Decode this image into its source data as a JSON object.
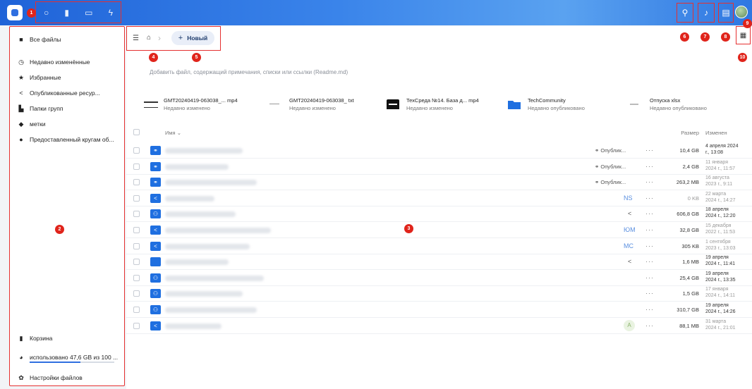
{
  "topbar": {
    "apps": [
      {
        "icon": "circle-icon",
        "glyph": "○"
      },
      {
        "icon": "document-icon",
        "glyph": "▮"
      },
      {
        "icon": "image-icon",
        "glyph": "▭"
      },
      {
        "icon": "bolt-icon",
        "glyph": "ϟ"
      }
    ],
    "right_icons": [
      {
        "icon": "search-icon",
        "glyph": "⚲"
      },
      {
        "icon": "bell-icon",
        "glyph": "♪"
      },
      {
        "icon": "contacts-icon",
        "glyph": "▤"
      }
    ]
  },
  "markers": [
    "1",
    "2",
    "3",
    "4",
    "5",
    "6",
    "7",
    "8",
    "9",
    "10"
  ],
  "sidebar": {
    "items": [
      {
        "label": "Все файлы",
        "icon": "folder-icon",
        "glyph": "■"
      },
      {
        "label": "Недавно изменённые",
        "icon": "clock-icon",
        "glyph": "◷"
      },
      {
        "label": "Избранные",
        "icon": "star-icon",
        "glyph": "★"
      },
      {
        "label": "Опубликованные ресур...",
        "icon": "share-icon",
        "glyph": "<"
      },
      {
        "label": "Папки групп",
        "icon": "group-folder-icon",
        "glyph": "▙"
      },
      {
        "label": "метки",
        "icon": "tag-icon",
        "glyph": "◆"
      },
      {
        "label": "Предоставленный кругам об...",
        "icon": "circles-icon",
        "glyph": "●"
      }
    ],
    "bottom": {
      "trash": "Корзина",
      "quota": "использовано 47,6 GB из 100 ...",
      "settings": "Настройки файлов"
    },
    "quota_fraction": 0.6
  },
  "breadcrumb": {
    "new_button": "Новый"
  },
  "readme_hint": "Добавить файл, содержащий примечания, списки или ссылки (Readme.md)",
  "recent": [
    {
      "title": "GMT20240419-063038_... mp4",
      "subtitle": "Недавно изменено"
    },
    {
      "title": "GMT20240419-063038_ txt",
      "subtitle": "Недавно изменено"
    },
    {
      "title": "ТехСреда №14. База д... mp4",
      "subtitle": "Недавно изменено"
    },
    {
      "title": "TechCommunity",
      "subtitle": "Недавно опубликовано"
    },
    {
      "title": "Отпуска xlsx",
      "subtitle": "Недавно опубликовано"
    }
  ],
  "table": {
    "columns": {
      "name": "Имя",
      "size": "Размер",
      "modified": "Изменен"
    },
    "rows": [
      {
        "icon": "link",
        "share": "Опублик...",
        "size": "10,4 GB",
        "mod1": "4 апреля 2024",
        "mod2": "г., 13:08",
        "dim": false
      },
      {
        "icon": "link",
        "share": "Опублик...",
        "size": "2,4 GB",
        "mod1": "11 января",
        "mod2": "2024 г., 11:57",
        "dim": true
      },
      {
        "icon": "link",
        "share": "Опублик...",
        "size": "263,2 MB",
        "mod1": "16 августа",
        "mod2": "2023 г., 9:11",
        "dim": true
      },
      {
        "icon": "shared",
        "initials": "NS",
        "size": "0 KB",
        "mod1": "22 марта",
        "mod2": "2024 г., 14:27",
        "dim": true
      },
      {
        "icon": "group",
        "share_icon": true,
        "size": "606,8 GB",
        "mod1": "18 апреля",
        "mod2": "2024 г., 12:20",
        "dim": false
      },
      {
        "icon": "shared",
        "initials": "ЮМ",
        "size": "32,8 GB",
        "mod1": "15 декабря",
        "mod2": "2022 г., 11:53",
        "dim": true
      },
      {
        "icon": "shared",
        "initials": "МС",
        "size": "305 KB",
        "mod1": "1 сентября",
        "mod2": "2023 г., 13:03",
        "dim": true
      },
      {
        "icon": "folder",
        "share_icon": true,
        "size": "1,6 MB",
        "mod1": "19 апреля",
        "mod2": "2024 г., 11:41",
        "dim": false
      },
      {
        "icon": "group",
        "size": "25,4 GB",
        "mod1": "19 апреля",
        "mod2": "2024 г., 13:35",
        "dim": false
      },
      {
        "icon": "group",
        "size": "1,5 GB",
        "mod1": "17 января",
        "mod2": "2024 г., 14:11",
        "dim": true
      },
      {
        "icon": "group",
        "size": "310,7 GB",
        "mod1": "19 апреля",
        "mod2": "2024 г., 14:26",
        "dim": false
      },
      {
        "icon": "shared",
        "ghost": "A",
        "size": "88,1 MB",
        "mod1": "31 марта",
        "mod2": "2024 г., 21:01",
        "dim": true
      }
    ]
  }
}
